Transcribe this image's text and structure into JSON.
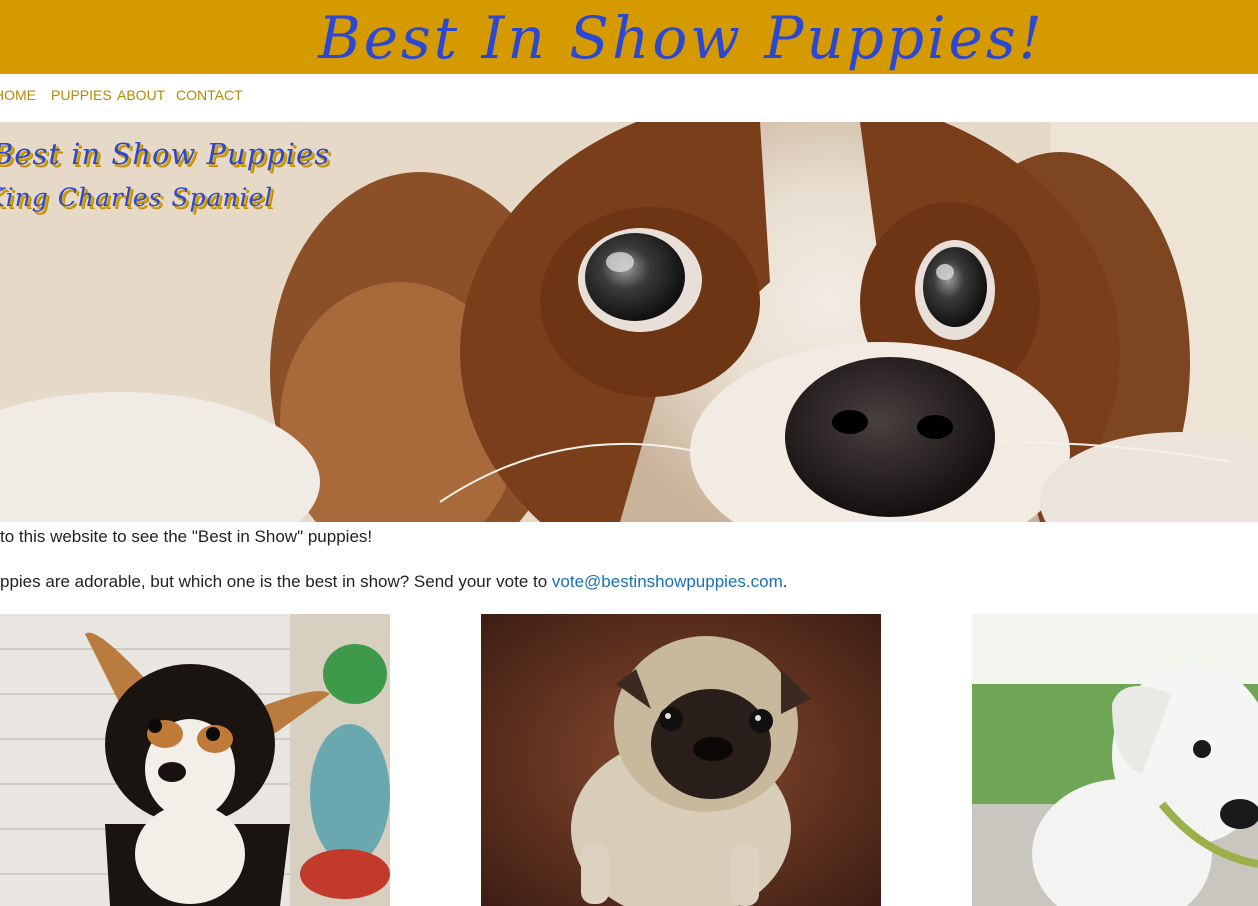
{
  "header": {
    "title": "Best In Show Puppies!"
  },
  "nav": {
    "items": [
      {
        "label": "HOME"
      },
      {
        "label": "PUPPIES"
      },
      {
        "label": "ABOUT"
      },
      {
        "label": "CONTACT"
      }
    ]
  },
  "hero": {
    "title": "Best in Show Puppies",
    "subtitle": "King Charles Spaniel",
    "image_icon": "spaniel-photo"
  },
  "content": {
    "intro_text": "to this website to see the \"Best in Show\" puppies!",
    "vote_text": "ppies are adorable, but which one is the best in show? Send your vote to ",
    "vote_email": "vote@bestinshowpuppies.com",
    "vote_end": "."
  },
  "gallery": {
    "cards": [
      {
        "icon": "corgi-puppy-photo"
      },
      {
        "icon": "pug-puppy-photo"
      },
      {
        "icon": "white-puppy-photo"
      }
    ]
  },
  "colors": {
    "header_bg": "#d49a00",
    "title_blue": "#2a48d4",
    "nav_gold": "#b58905",
    "link_blue": "#1a6fb8"
  }
}
